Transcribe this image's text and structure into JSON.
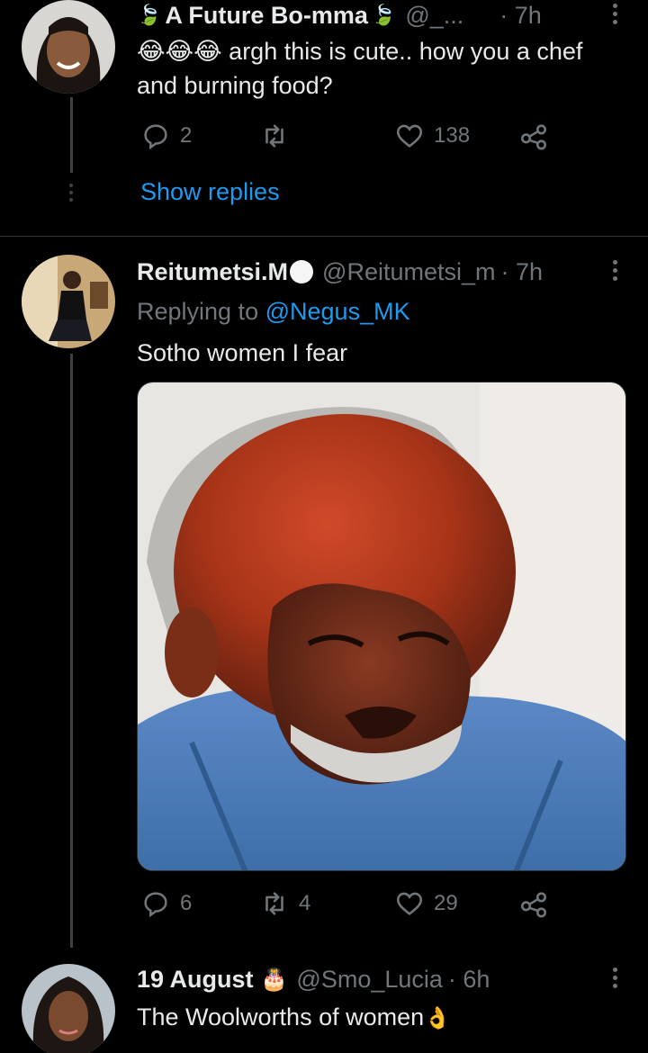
{
  "tweet1": {
    "name": "A Future Bo-mma",
    "handle": "@_...",
    "time": "· 7h",
    "text": "argh this is cute.. how you a chef and burning food?",
    "replies": "2",
    "retweets": "",
    "likes": "138",
    "show_replies": "Show replies"
  },
  "tweet2": {
    "name": "Reitumetsi.M",
    "handle": "@Reitumetsi_m",
    "time": "· 7h",
    "replying_prefix": "Replying to",
    "replying_to": "@Negus_MK",
    "text": "Sotho women I fear",
    "replies": "6",
    "retweets": "4",
    "likes": "29"
  },
  "tweet3": {
    "name": "19 August",
    "handle": "@Smo_Lucia",
    "time": "· 6h",
    "text": "The Woolworths of women"
  },
  "colors": {
    "background": "#000000",
    "text_primary": "#e7e9ea",
    "text_secondary": "#71767b",
    "accent": "#1d9bf0",
    "divider": "#2f3336"
  },
  "icons": [
    "reply-icon",
    "retweet-icon",
    "like-icon",
    "share-icon",
    "more-icon",
    "leaf-emoji",
    "laughing-emoji",
    "cake-emoji",
    "ok-hand-emoji",
    "verified-circle"
  ]
}
